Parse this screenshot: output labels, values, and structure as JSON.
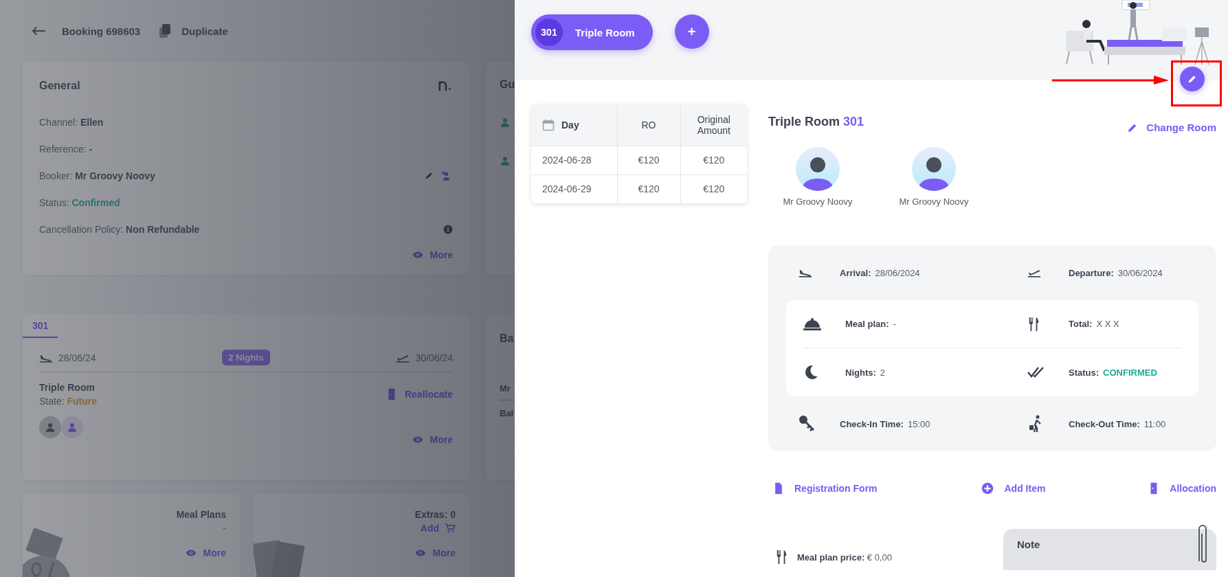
{
  "background_page": {
    "header": {
      "title": "Booking 698603",
      "duplicate": "Duplicate"
    },
    "general_card": {
      "title": "General",
      "fields": [
        {
          "label": "Channel:",
          "value": "Ellen",
          "kind": "plain"
        },
        {
          "label": "Reference:",
          "value": "-",
          "kind": "plain"
        },
        {
          "label": "Booker:",
          "value": "Mr Groovy Noovy",
          "kind": "booker"
        },
        {
          "label": "Status:",
          "value": "Confirmed",
          "kind": "status"
        },
        {
          "label": "Cancellation Policy:",
          "value": "Non Refundable",
          "kind": "policy"
        }
      ],
      "more": "More"
    },
    "guests_card": {
      "title": "Gu"
    },
    "room_card": {
      "tabs": [
        {
          "label": "301",
          "selected": true
        }
      ],
      "arrival": "28/06/24",
      "nights": "2 Nights",
      "departure": "30/06/24",
      "room": "Triple Room",
      "state_label": "State:",
      "state": "Future",
      "reallocate": "Reallocate",
      "more": "More"
    },
    "balance_card": {
      "title": "Ba",
      "rows": [
        "Mr",
        "Bal"
      ]
    },
    "meal_plans_card": {
      "title": "Meal Plans",
      "value": "-",
      "more": "More"
    },
    "extras_card": {
      "title": "Extras: 0",
      "add": "Add",
      "more": "More"
    }
  },
  "drawer": {
    "room_pill": {
      "number": "301",
      "name": "Triple Room"
    },
    "add_button": "+",
    "rates_table": {
      "columns": [
        "Day",
        "RO",
        "Original Amount"
      ],
      "rows": [
        [
          "2024-06-28",
          "€120",
          "€120"
        ],
        [
          "2024-06-29",
          "€120",
          "€120"
        ]
      ]
    },
    "room_title": {
      "name": "Triple Room",
      "number": "301"
    },
    "change_room": "Change Room",
    "guests": [
      "Mr Groovy Noovy",
      "Mr Groovy Noovy"
    ],
    "stay": {
      "travel": [
        {
          "label": "Arrival:",
          "value": "28/06/2024"
        },
        {
          "label": "Departure:",
          "value": "30/06/2024"
        }
      ],
      "details": [
        {
          "label": "Meal plan:",
          "value": "-",
          "kind": "plain"
        },
        {
          "label": "Total:",
          "value": "X X X",
          "kind": "plain"
        },
        {
          "label": "Nights:",
          "value": "2",
          "kind": "plain"
        },
        {
          "label": "Status:",
          "value": "CONFIRMED",
          "kind": "status"
        }
      ],
      "times": [
        {
          "label": "Check-In Time:",
          "value": "15:00"
        },
        {
          "label": "Check-Out Time:",
          "value": "11:00"
        }
      ]
    },
    "actions": [
      "Registration Form",
      "Add Item",
      "Allocation"
    ],
    "meal_plan_price": {
      "label": "Meal plan price:",
      "value": "€ 0,00"
    },
    "note": {
      "title": "Note"
    }
  }
}
